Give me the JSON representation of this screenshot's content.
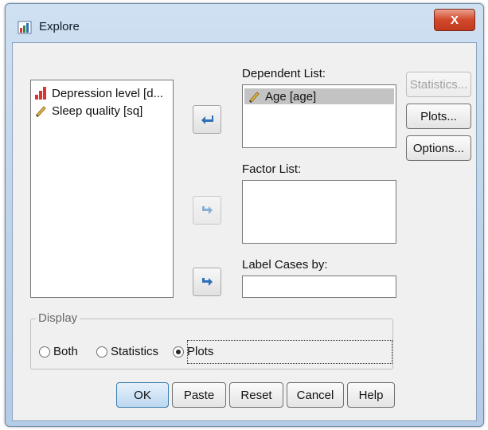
{
  "window": {
    "title": "Explore",
    "close_label": "X"
  },
  "variables": [
    {
      "label": "Depression level [d...",
      "icon": "ordinal-measure-icon"
    },
    {
      "label": "Sleep quality [sq]",
      "icon": "scale-measure-icon"
    }
  ],
  "dependent_list": {
    "label": "Dependent List:",
    "items": [
      {
        "label": "Age [age]",
        "icon": "scale-measure-icon",
        "selected": true
      }
    ]
  },
  "factor_list": {
    "label": "Factor List:",
    "items": []
  },
  "label_cases": {
    "label": "Label Cases by:",
    "value": ""
  },
  "side_buttons": {
    "statistics": "Statistics...",
    "plots": "Plots...",
    "options": "Options..."
  },
  "display": {
    "legend": "Display",
    "options": [
      "Both",
      "Statistics",
      "Plots"
    ],
    "selected": "Plots"
  },
  "footer_buttons": {
    "ok": "OK",
    "paste": "Paste",
    "reset": "Reset",
    "cancel": "Cancel",
    "help": "Help"
  },
  "colors": {
    "title_gradient": "#bcd2ea",
    "close_red": "#d2482b",
    "selection_gray": "#c3c3c3",
    "arrow_blue": "#2e6fb8"
  }
}
